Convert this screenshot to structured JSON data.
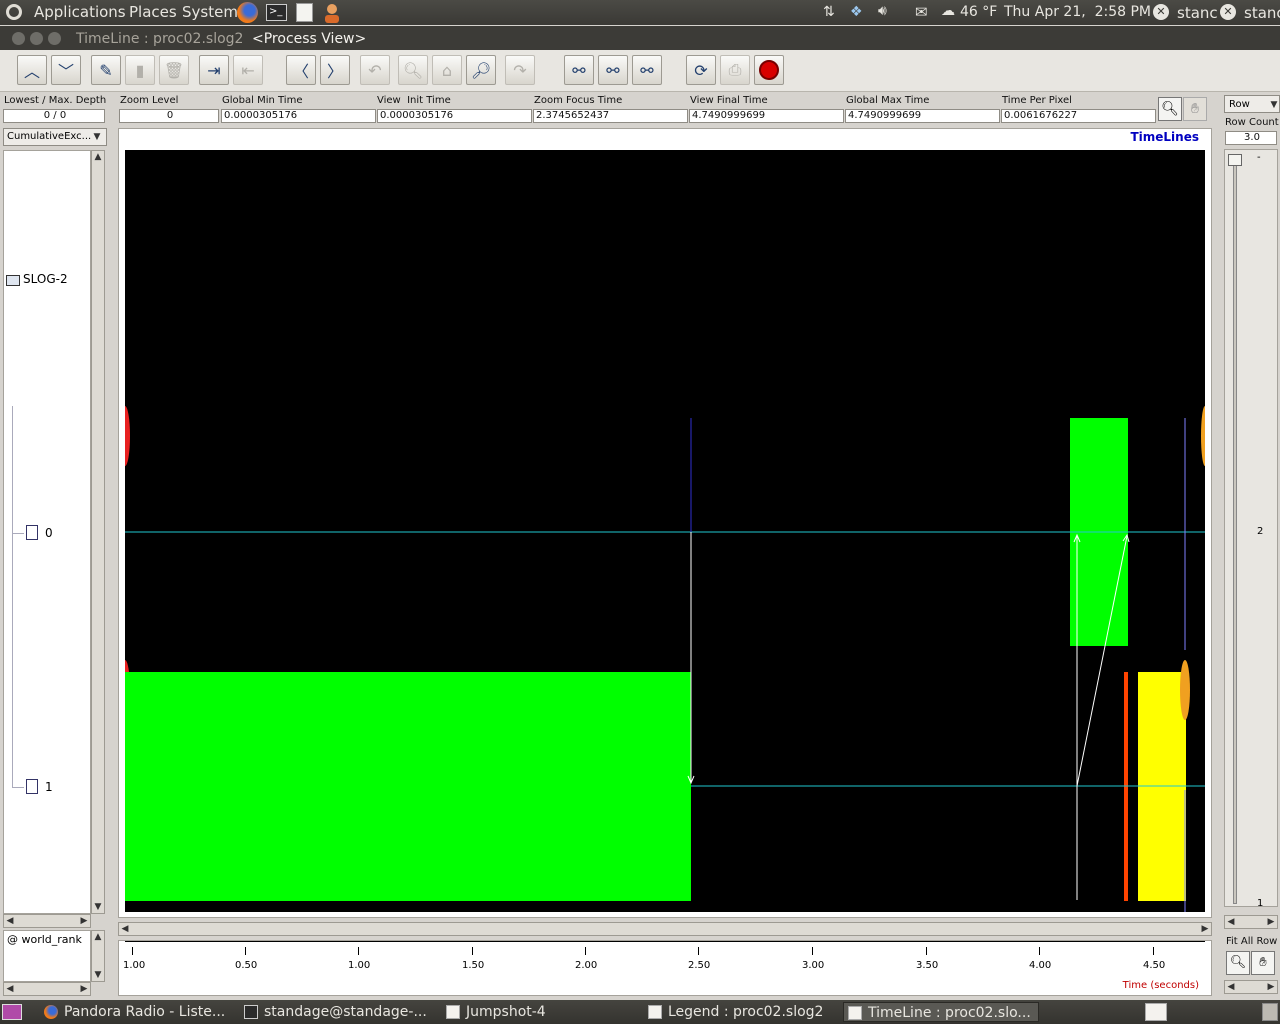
{
  "topbar": {
    "menus": [
      "Applications",
      "Places",
      "System"
    ],
    "weather": "46 °F",
    "clock": "Thu Apr 21,  2:58 PM",
    "user1": "stanc",
    "user2": "stanc"
  },
  "window": {
    "title": "TimeLine : proc02.slog2",
    "view": "<Process View>"
  },
  "info": {
    "depth_label": "Lowest / Max. Depth",
    "depth_value": "0 / 0",
    "zoom_label": "Zoom Level",
    "zoom_value": "0",
    "gmin_label": "Global Min Time",
    "gmin_value": "0.0000305176",
    "vinit_label": "View  Init Time",
    "vinit_value": "0.0000305176",
    "zfocus_label": "Zoom Focus Time",
    "zfocus_value": "2.3745652437",
    "vfinal_label": "View Final Time",
    "vfinal_value": "4.7490999699",
    "gmax_label": "Global Max Time",
    "gmax_value": "4.7490999699",
    "tpp_label": "Time Per Pixel",
    "tpp_value": "0.0061676227"
  },
  "left_panel": {
    "dropdown": "CumulativeExc...",
    "tree_root": "SLOG-2",
    "rows": [
      "0",
      "1"
    ],
    "bottom": "@ world_rank"
  },
  "right_panel": {
    "dropdown": "Row",
    "row_count_label": "Row Count",
    "row_count_value": "3.0",
    "ruler_top": "-",
    "ruler_mid": "2",
    "ruler_bottom": "1",
    "fit_label": "Fit All Row"
  },
  "canvas": {
    "title": "TimeLines"
  },
  "time_axis": {
    "ticks": [
      "1.00",
      "0.50",
      "1.00",
      "1.50",
      "2.00",
      "2.50",
      "3.00",
      "3.50",
      "4.00",
      "4.50"
    ],
    "label": "Time (seconds)"
  },
  "taskbar": {
    "items": [
      "Pandora Radio - Liste...",
      "standage@standage-...",
      "Jumpshot-4",
      "Legend : proc02.slog2",
      "TimeLine : proc02.slo..."
    ]
  },
  "colors": {
    "state_green": "#00ff00",
    "state_yellow": "#ffff00",
    "state_orange": "#ff4400",
    "timeline_cyan": "#1fc8d0",
    "title_blue": "#0000c0"
  }
}
